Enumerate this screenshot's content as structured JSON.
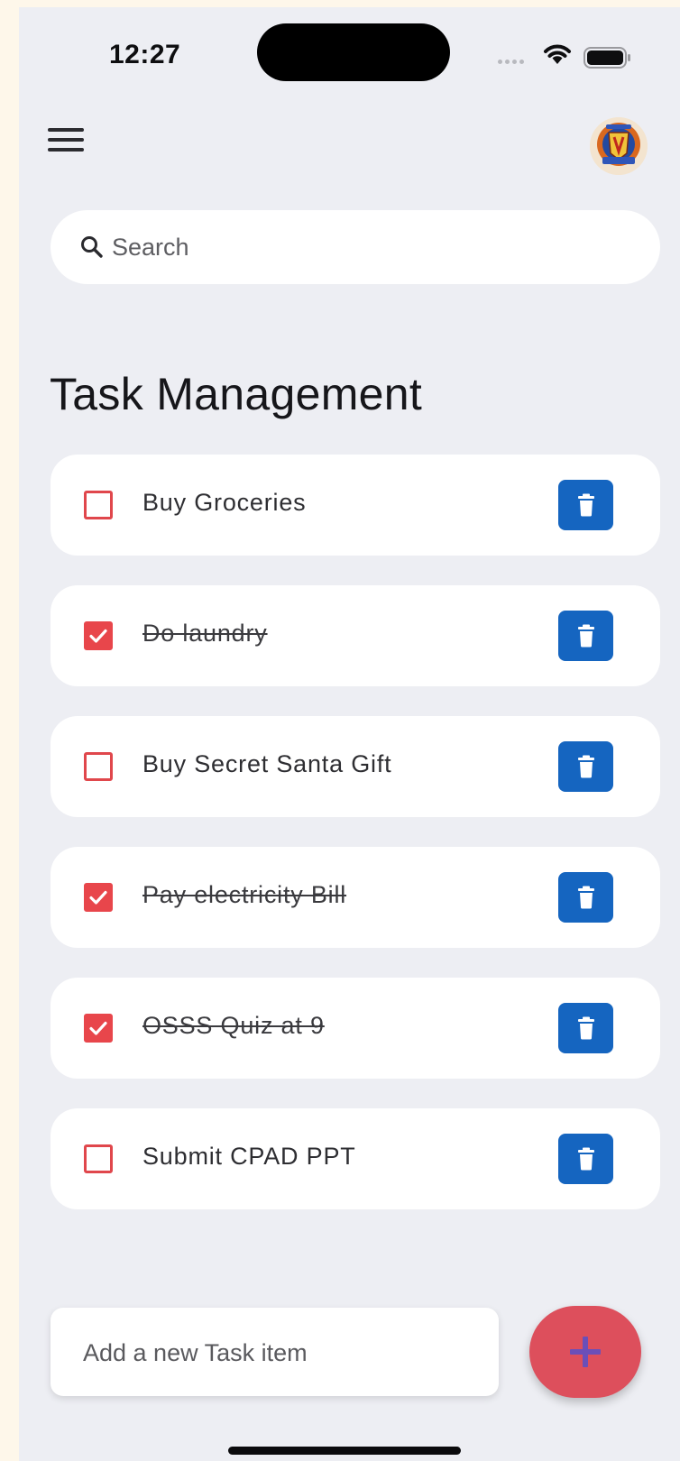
{
  "status_bar": {
    "time": "12:27"
  },
  "app_bar": {
    "menu_icon": "hamburger-menu-icon",
    "avatar_icon": "institution-logo-avatar"
  },
  "search": {
    "placeholder": "Search",
    "value": "",
    "icon": "search-icon"
  },
  "title": "Task Management",
  "tasks": [
    {
      "label": "Buy Groceries",
      "done": false
    },
    {
      "label": "Do laundry",
      "done": true
    },
    {
      "label": "Buy Secret Santa Gift",
      "done": false
    },
    {
      "label": "Pay electricity Bill",
      "done": true
    },
    {
      "label": "OSSS Quiz at 9",
      "done": true
    },
    {
      "label": "Submit CPAD PPT",
      "done": false
    }
  ],
  "new_task": {
    "placeholder": "Add a new Task item",
    "value": ""
  },
  "add_button": {
    "icon": "plus-icon"
  },
  "colors": {
    "background": "#edeef3",
    "card": "#ffffff",
    "checkbox": "#e8464b",
    "delete_button": "#1565c0",
    "fab": "#dd4f5c",
    "fab_icon": "#6b4fb8"
  }
}
